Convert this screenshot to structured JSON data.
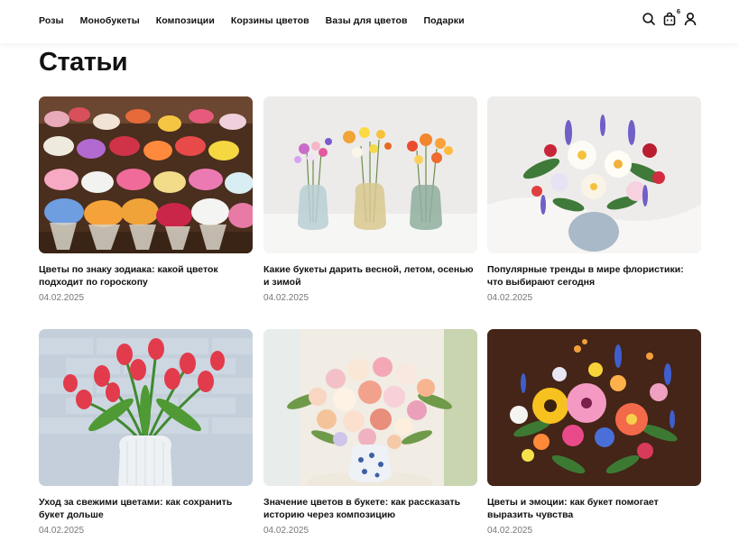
{
  "nav": {
    "items": [
      {
        "label": "Розы"
      },
      {
        "label": "Монобукеты"
      },
      {
        "label": "Композиции"
      },
      {
        "label": "Корзины цветов"
      },
      {
        "label": "Вазы для цветов"
      },
      {
        "label": "Подарки"
      }
    ]
  },
  "header_icons": {
    "search": "search-icon",
    "cart": "shopping-bag-icon",
    "cart_count": "6",
    "user": "user-icon"
  },
  "page": {
    "title": "Статьи"
  },
  "articles": [
    {
      "title": "Цветы по знаку зодиака: какой цветок подходит по гороскопу",
      "date": "04.02.2025",
      "image": "flower-market-photo"
    },
    {
      "title": "Какие букеты дарить весной, летом, осенью и зимой",
      "date": "04.02.2025",
      "image": "three-vases-photo"
    },
    {
      "title": "Популярные тренды в мире флористики: что выбирают сегодня",
      "date": "04.02.2025",
      "image": "lilies-bouquet-photo"
    },
    {
      "title": "Уход за свежими цветами: как сохранить букет дольше",
      "date": "04.02.2025",
      "image": "red-tulips-photo"
    },
    {
      "title": "Значение цветов в букете: как рассказать историю через композицию",
      "date": "04.02.2025",
      "image": "pastel-bouquet-photo"
    },
    {
      "title": "Цветы и эмоции: как букет помогает выразить чувства",
      "date": "04.02.2025",
      "image": "colorful-bouquet-photo"
    }
  ]
}
